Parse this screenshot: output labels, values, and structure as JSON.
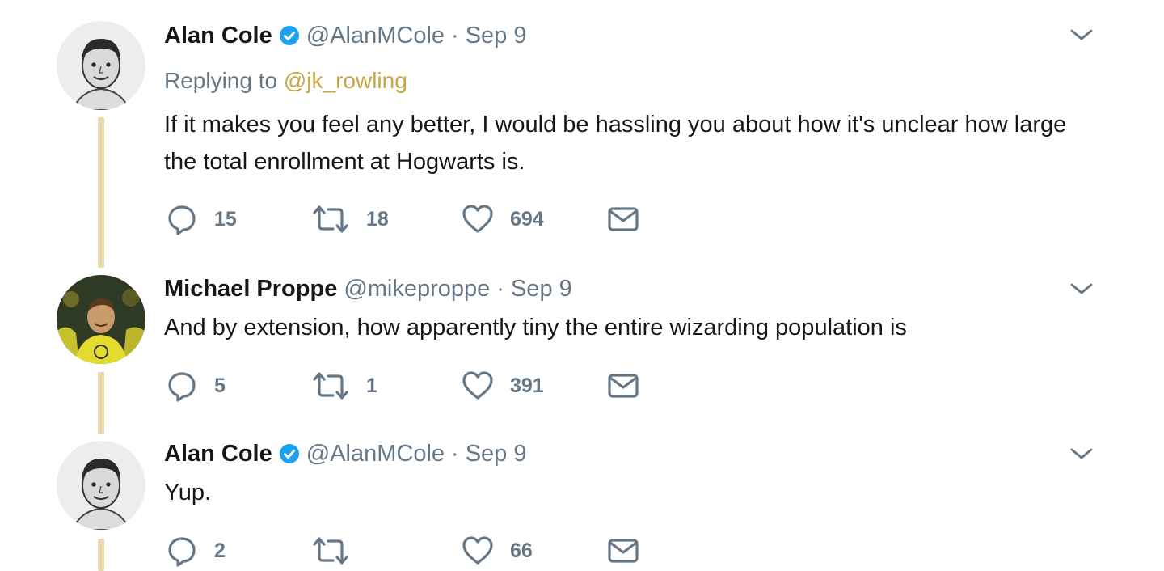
{
  "tweets": [
    {
      "name": "Alan Cole",
      "verified": true,
      "handle": "@AlanMCole",
      "sep": "·",
      "date": "Sep 9",
      "replying_label": "Replying to",
      "replying_to": "@jk_rowling",
      "text": "If it makes you feel any better, I would be hassling you about how it's unclear how large the total enrollment at Hogwarts is.",
      "replies": "15",
      "retweets": "18",
      "likes": "694"
    },
    {
      "name": "Michael Proppe",
      "verified": false,
      "handle": "@mikeproppe",
      "sep": "·",
      "date": "Sep 9",
      "text": "And by extension, how apparently tiny the entire wizarding population is",
      "replies": "5",
      "retweets": "1",
      "likes": "391"
    },
    {
      "name": "Alan Cole",
      "verified": true,
      "handle": "@AlanMCole",
      "sep": "·",
      "date": "Sep 9",
      "text": "Yup.",
      "replies": "2",
      "retweets": "",
      "likes": "66"
    }
  ],
  "colors": {
    "thread_line": "#e6d9ad",
    "verified_blue": "#1da1f2",
    "muted": "#657786",
    "mention": "#c8a646"
  },
  "icons": [
    "reply-icon",
    "retweet-icon",
    "like-icon",
    "message-icon",
    "chevron-down-icon",
    "verified-badge-icon"
  ]
}
